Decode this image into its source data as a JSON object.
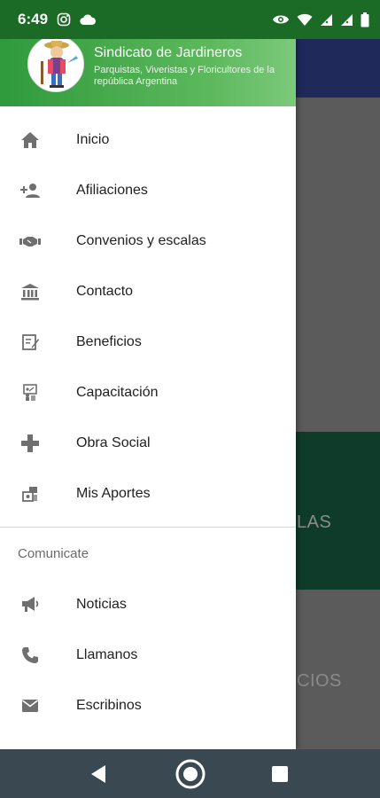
{
  "status_bar": {
    "time": "6:49",
    "icons": [
      "instagram-icon",
      "cloud-icon",
      "eye-icon",
      "wifi-icon",
      "signal-icon",
      "signal-icon",
      "battery-icon"
    ]
  },
  "background": {
    "text_1": "LAS",
    "text_2": "CIOS"
  },
  "drawer": {
    "header": {
      "title": "Sindicato de Jardineros",
      "subtitle": "Parquistas, Viveristas y Floricultores de la república Argentina"
    },
    "items": [
      {
        "label": "Inicio",
        "icon": "home-icon"
      },
      {
        "label": "Afiliaciones",
        "icon": "person-add-icon"
      },
      {
        "label": "Convenios y escalas",
        "icon": "handshake-icon"
      },
      {
        "label": "Contacto",
        "icon": "bank-icon"
      },
      {
        "label": "Beneficios",
        "icon": "edit-document-icon"
      },
      {
        "label": "Capacitación",
        "icon": "training-icon"
      },
      {
        "label": "Obra Social",
        "icon": "medical-cross-icon"
      },
      {
        "label": "Mis Aportes",
        "icon": "money-icon"
      }
    ],
    "section_title": "Comunicate",
    "section_items": [
      {
        "label": "Noticias",
        "icon": "megaphone-icon"
      },
      {
        "label": "Llamanos",
        "icon": "phone-icon"
      },
      {
        "label": "Escribinos",
        "icon": "mail-icon"
      }
    ]
  },
  "colors": {
    "status_bar": "#1b6a26",
    "header_start": "#2f9a3c",
    "header_end": "#7cc97b",
    "icon": "#6f6f6f",
    "nav_bar": "#3a4852"
  }
}
